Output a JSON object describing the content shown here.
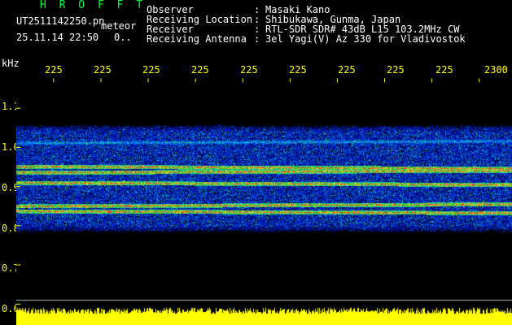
{
  "header": {
    "brand": "H R O F F T",
    "file": "UT2511142250.pn",
    "mode": "meteor",
    "date": "25.11.14 22:50",
    "counter": "0..",
    "rows": [
      {
        "label": "Observer",
        "value": "Masaki Kano"
      },
      {
        "label": "Receiving Location",
        "value": "Shibukawa, Gunma, Japan"
      },
      {
        "label": "Receiver",
        "value": "RTL-SDR SDR# 43dB L15 103.2MHz CW"
      },
      {
        "label": "Receiving Antenna",
        "value": "3el Yagi(V) Az 330 for Vladivostok"
      }
    ]
  },
  "axis_unit": "kHz",
  "chart_data": {
    "type": "heatmap",
    "x_tick_labels": [
      "225",
      "225",
      "225",
      "225",
      "225",
      "225",
      "225",
      "225",
      "225",
      "2300"
    ],
    "y_tick_labels": [
      "1.1",
      "1.0",
      "0.9",
      "0.8",
      "0.7",
      "0.6"
    ],
    "ylim": [
      0.58,
      1.12
    ],
    "signal_bands_khz": [
      1.01,
      0.952,
      0.937,
      0.912,
      0.854,
      0.842
    ],
    "noise_region_khz": [
      0.79,
      1.055
    ],
    "bottom_strip_color": "#ffff00",
    "colors": {
      "noise": "#1030c0",
      "mid": "#20c080",
      "peak": "#ff3030",
      "tick": "#ffff00"
    }
  }
}
